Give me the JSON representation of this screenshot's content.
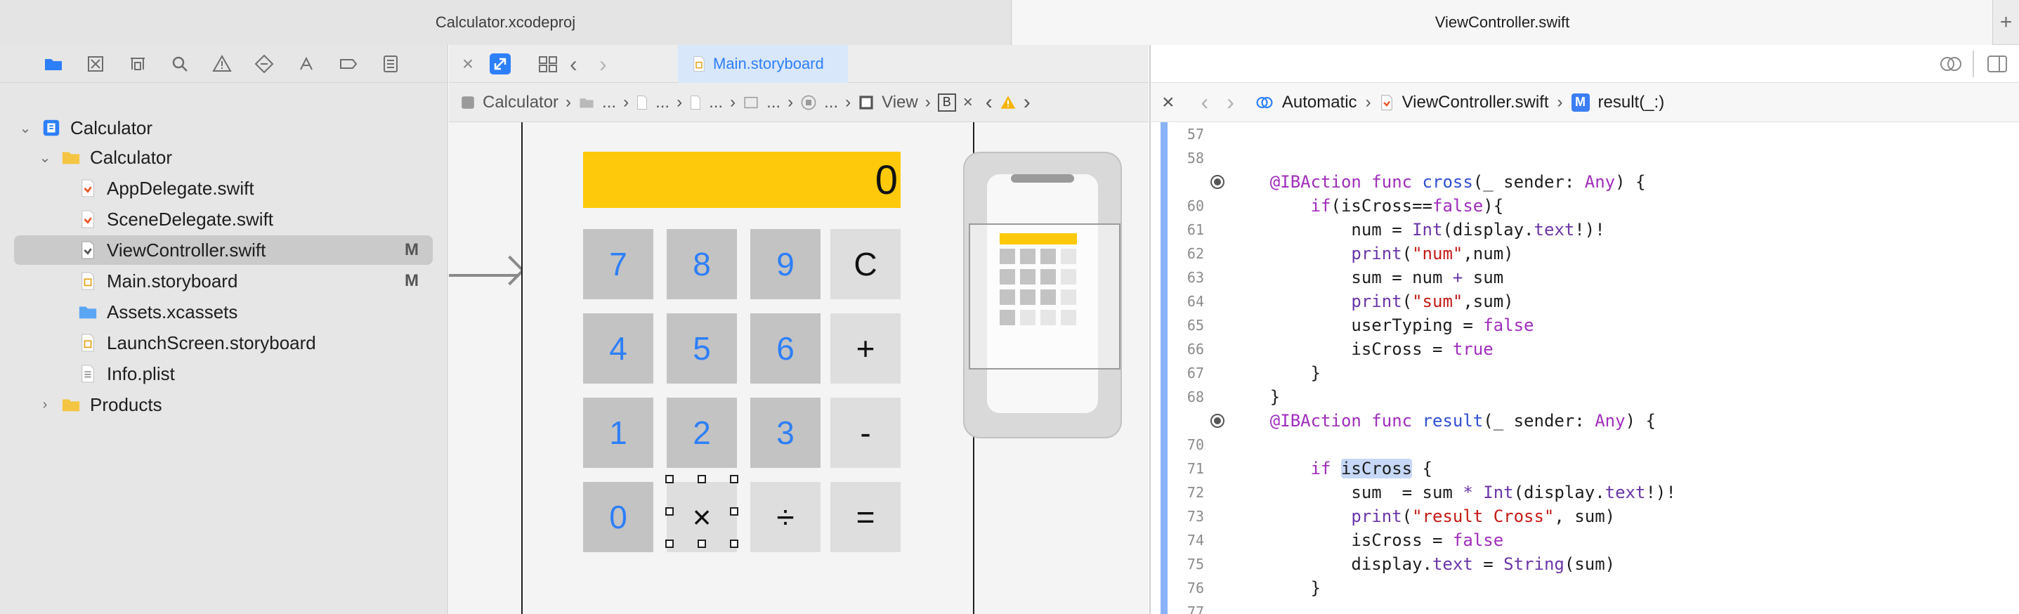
{
  "window_tabs": {
    "tab1": "Calculator.xcodeproj",
    "tab2": "ViewController.swift",
    "add": "+"
  },
  "navigator": {
    "tree": [
      {
        "label": "Calculator",
        "badge": ""
      },
      {
        "label": "Calculator",
        "badge": ""
      },
      {
        "label": "AppDelegate.swift",
        "badge": ""
      },
      {
        "label": "SceneDelegate.swift",
        "badge": ""
      },
      {
        "label": "ViewController.swift",
        "badge": "M"
      },
      {
        "label": "Main.storyboard",
        "badge": "M"
      },
      {
        "label": "Assets.xcassets",
        "badge": ""
      },
      {
        "label": "LaunchScreen.storyboard",
        "badge": ""
      },
      {
        "label": "Info.plist",
        "badge": ""
      },
      {
        "label": "Products",
        "badge": ""
      }
    ]
  },
  "canvas": {
    "active_tab": "Main.storyboard",
    "jumpbar": {
      "first": "Calculator",
      "ellipsis": "...",
      "view": "View",
      "b": "B"
    },
    "calculator": {
      "display": "0",
      "buttons": [
        "7",
        "8",
        "9",
        "C",
        "4",
        "5",
        "6",
        "+",
        "1",
        "2",
        "3",
        "-",
        "0",
        "×",
        "÷",
        "="
      ]
    }
  },
  "editor": {
    "jumpbar": {
      "automatic": "Automatic",
      "file": "ViewController.swift",
      "m": "M",
      "symbol": "result(_:)"
    },
    "line_numbers": [
      "57",
      "58",
      "",
      "60",
      "61",
      "62",
      "63",
      "64",
      "65",
      "66",
      "67",
      "68",
      "",
      "70",
      "71",
      "72",
      "73",
      "74",
      "75",
      "76",
      "77"
    ]
  },
  "colors": {
    "display": "#fdc90a",
    "digit_text": "#2d7ff9",
    "accent": "#2d7ff9",
    "keyword": "#a02dbc",
    "string": "#c41a16"
  }
}
